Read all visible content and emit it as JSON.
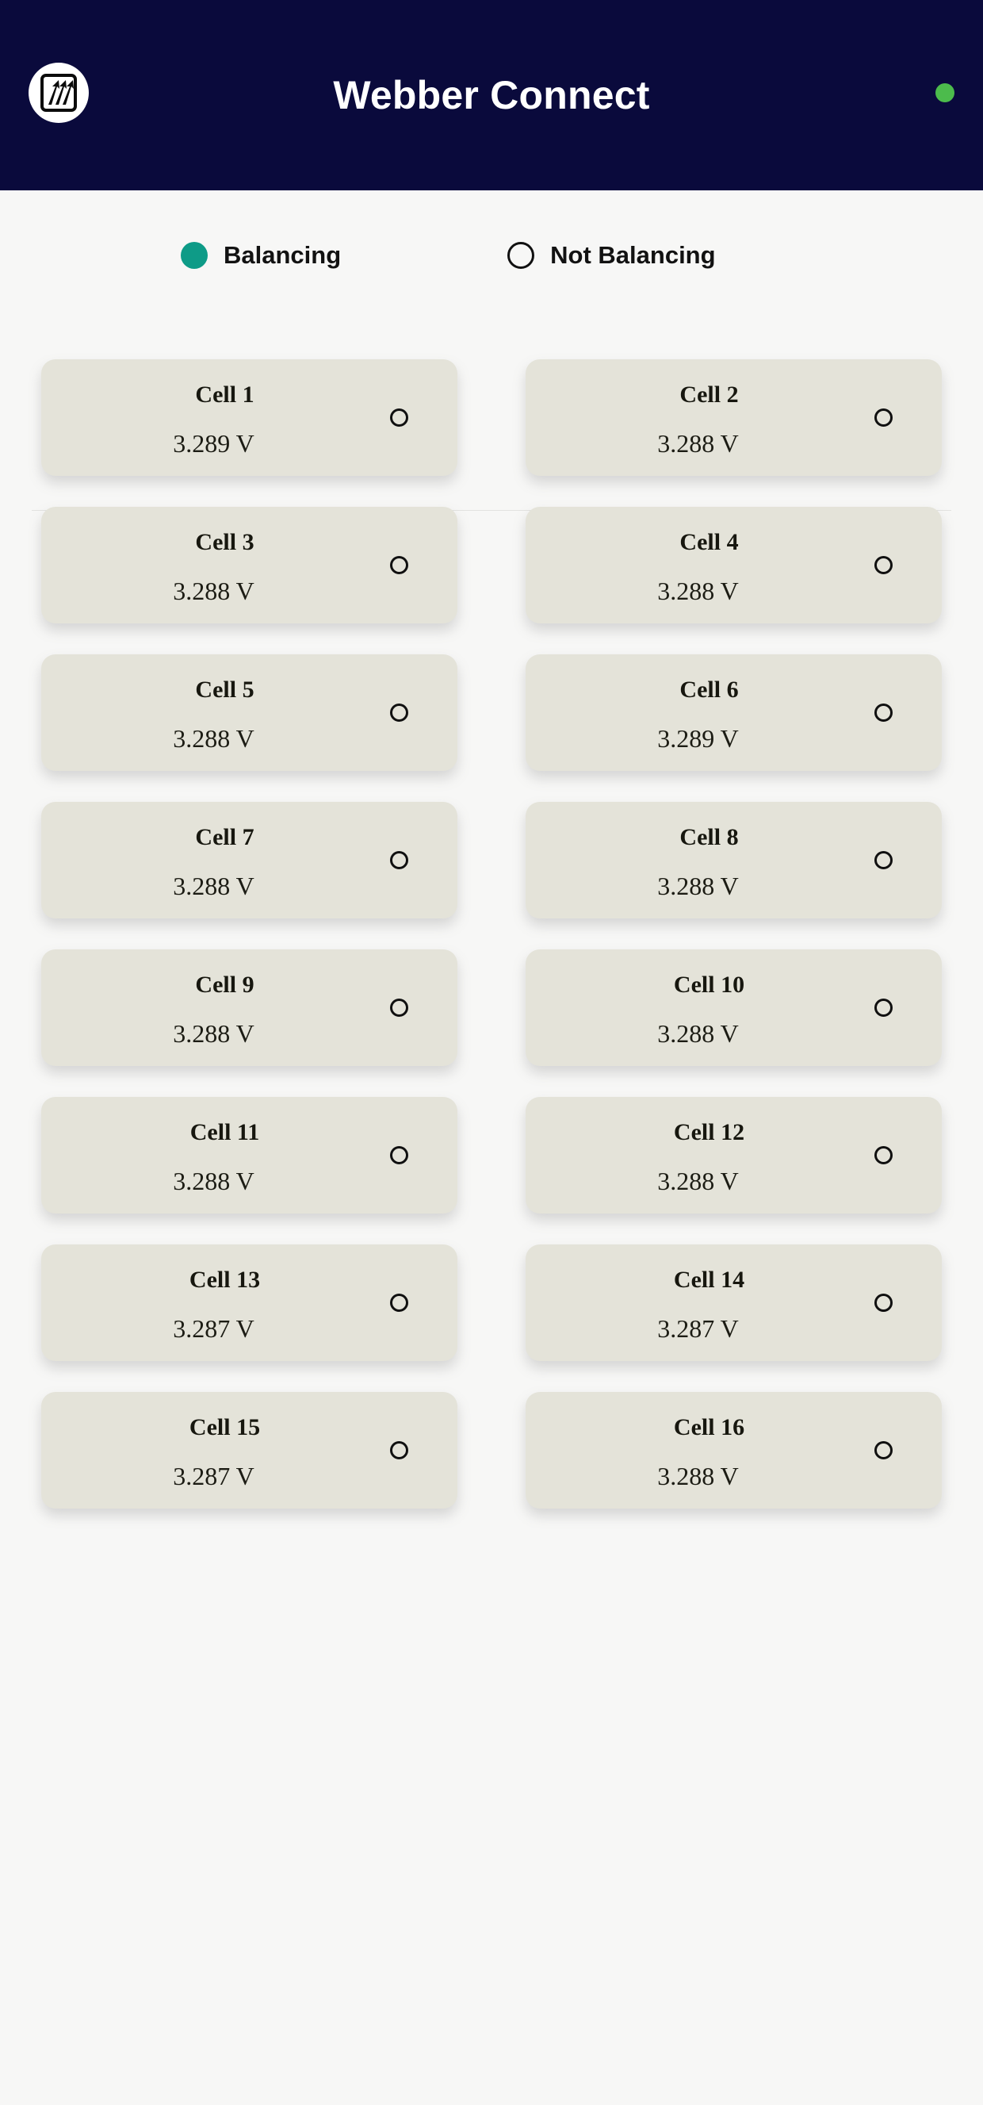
{
  "header": {
    "title": "Webber Connect",
    "logo_icon": "webber-arrows-logo",
    "connection_status_icon": "connection-status-dot",
    "connection_status_color": "#4CBB4C"
  },
  "theme": {
    "appbar_bg": "#0A0A3C",
    "page_bg": "#F7F7F6",
    "card_bg": "#E4E3D9",
    "balancing_color": "#0E9B87",
    "not_balancing_color": "#101010"
  },
  "legend": {
    "items": [
      {
        "label": "Balancing",
        "state": "balancing",
        "icon": "filled-circle-icon"
      },
      {
        "label": "Not Balancing",
        "state": "not_balancing",
        "icon": "hollow-circle-icon"
      }
    ]
  },
  "cells": [
    {
      "name": "Cell 1",
      "voltage": "3.289 V",
      "balancing": false
    },
    {
      "name": "Cell 2",
      "voltage": "3.288 V",
      "balancing": false
    },
    {
      "name": "Cell 3",
      "voltage": "3.288 V",
      "balancing": false
    },
    {
      "name": "Cell 4",
      "voltage": "3.288 V",
      "balancing": false
    },
    {
      "name": "Cell 5",
      "voltage": "3.288 V",
      "balancing": false
    },
    {
      "name": "Cell 6",
      "voltage": "3.289 V",
      "balancing": false
    },
    {
      "name": "Cell 7",
      "voltage": "3.288 V",
      "balancing": false
    },
    {
      "name": "Cell 8",
      "voltage": "3.288 V",
      "balancing": false
    },
    {
      "name": "Cell 9",
      "voltage": "3.288 V",
      "balancing": false
    },
    {
      "name": "Cell 10",
      "voltage": "3.288 V",
      "balancing": false
    },
    {
      "name": "Cell 11",
      "voltage": "3.288 V",
      "balancing": false
    },
    {
      "name": "Cell 12",
      "voltage": "3.288 V",
      "balancing": false
    },
    {
      "name": "Cell 13",
      "voltage": "3.287 V",
      "balancing": false
    },
    {
      "name": "Cell 14",
      "voltage": "3.287 V",
      "balancing": false
    },
    {
      "name": "Cell 15",
      "voltage": "3.287 V",
      "balancing": false
    },
    {
      "name": "Cell 16",
      "voltage": "3.288 V",
      "balancing": false
    }
  ]
}
